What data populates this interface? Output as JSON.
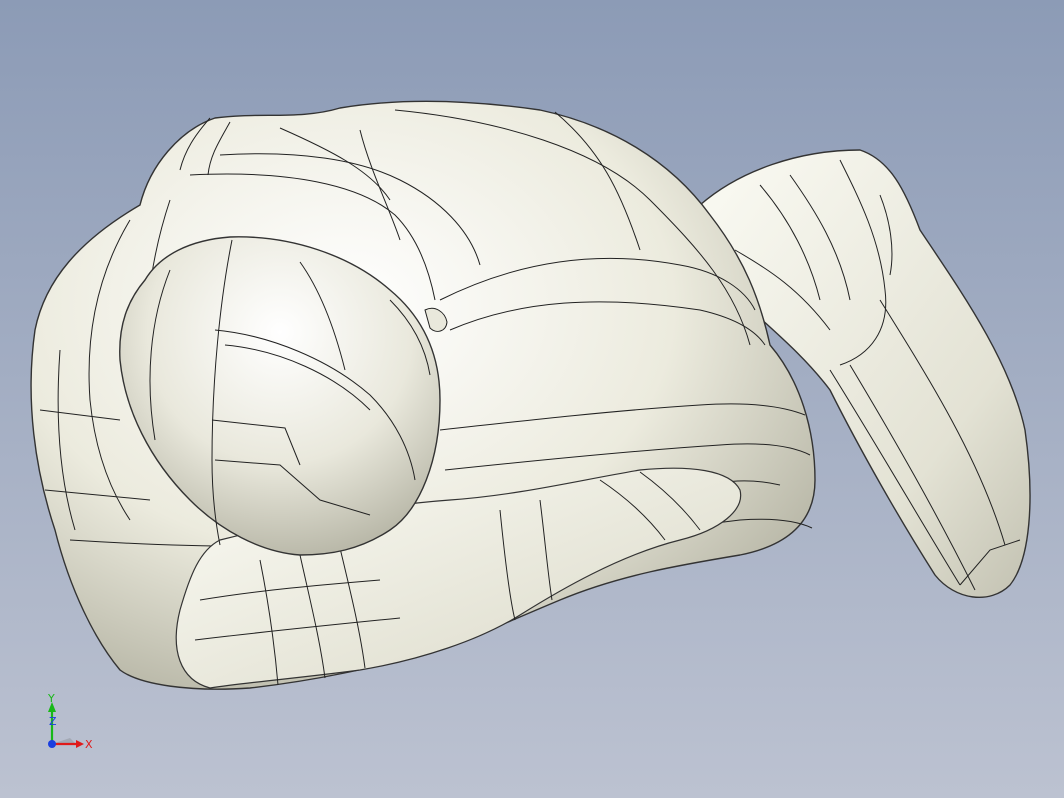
{
  "scene": {
    "background_top": "#8c9bb6",
    "background_bottom": "#bcc2d1",
    "model_fill": "#f2f2e8",
    "model_edge": "#111111"
  },
  "triad": {
    "x_label": "X",
    "y_label": "Y",
    "z_label": "Z",
    "x_color": "#e01a1a",
    "y_color": "#18b818",
    "z_color": "#1a3fe0"
  }
}
